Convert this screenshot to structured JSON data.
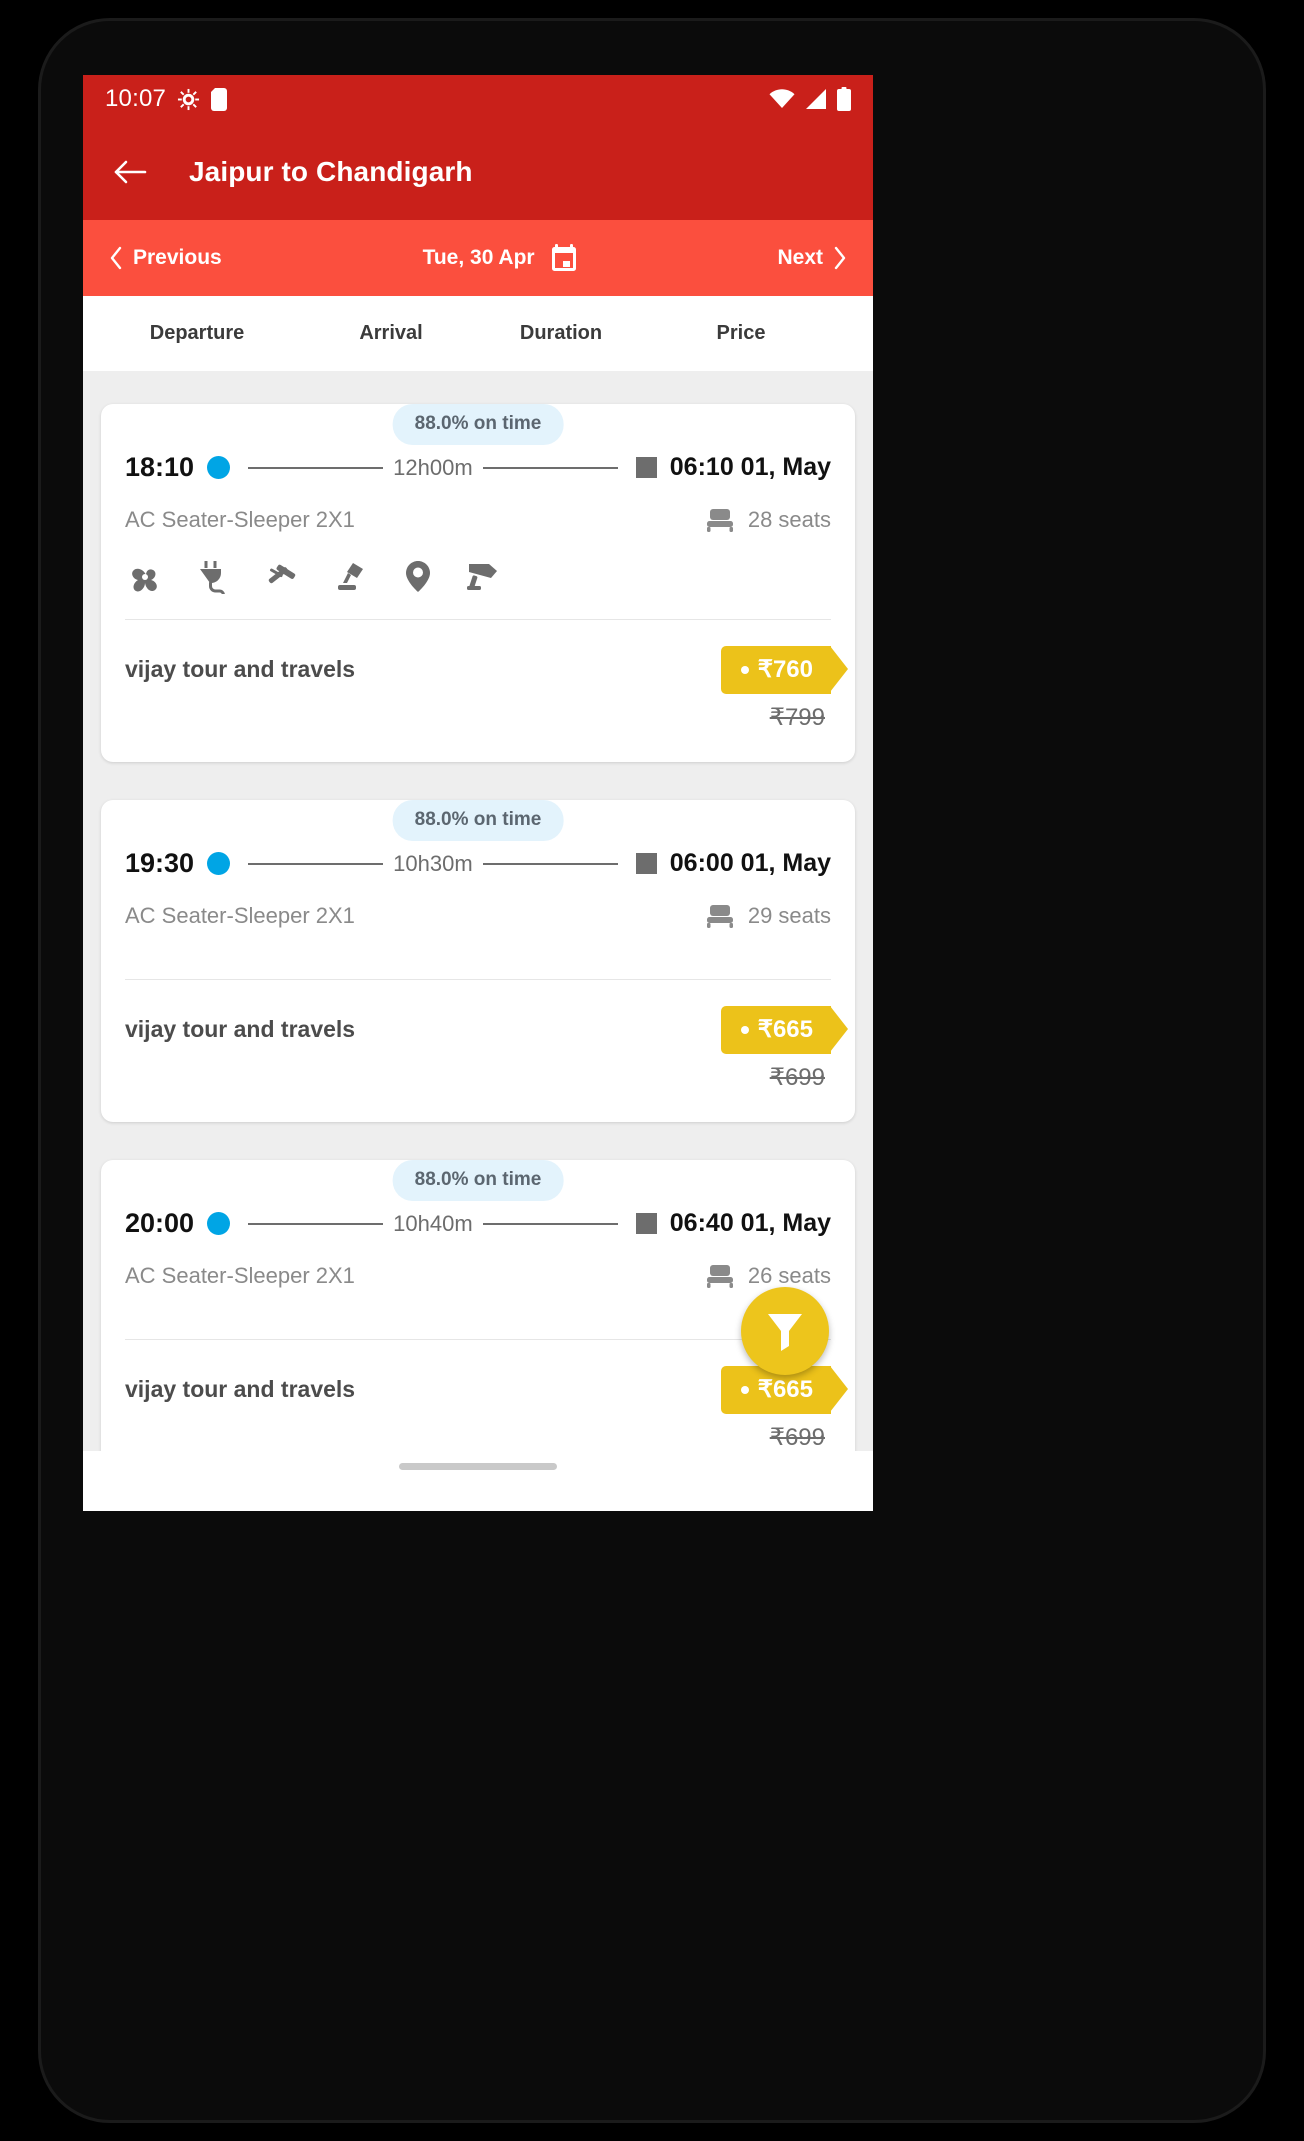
{
  "status_bar": {
    "time": "10:07",
    "icons": [
      "android-debug-icon",
      "sd-card-icon",
      "wifi-icon",
      "signal-icon",
      "battery-icon"
    ]
  },
  "app_bar": {
    "back_icon": "back-arrow-icon",
    "title": "Jaipur to Chandigarh"
  },
  "date_bar": {
    "previous_label": "Previous",
    "previous_icon": "chevron-left-icon",
    "date_label": "Tue, 30 Apr",
    "calendar_icon": "calendar-icon",
    "next_label": "Next",
    "next_icon": "chevron-right-icon"
  },
  "sort_headers": [
    {
      "label": "Departure"
    },
    {
      "label": "Arrival"
    },
    {
      "label": "Duration"
    },
    {
      "label": "Price"
    }
  ],
  "buses": [
    {
      "ontime": "88.0% on time",
      "departure": "18:10",
      "duration": "12h00m",
      "arrival": "06:10 01, May",
      "bus_type": "AC Seater-Sleeper 2X1",
      "seats": "28 seats",
      "amenities": [
        "fan-icon",
        "charging-point-icon",
        "hammer-icon",
        "reading-light-icon",
        "live-tracking-icon",
        "cctv-icon"
      ],
      "operator": "vijay tour and travels",
      "price": "₹760",
      "price_old": "₹799"
    },
    {
      "ontime": "88.0% on time",
      "departure": "19:30",
      "duration": "10h30m",
      "arrival": "06:00 01, May",
      "bus_type": "AC Seater-Sleeper 2X1",
      "seats": "29 seats",
      "amenities": [],
      "operator": "vijay tour and travels",
      "price": "₹665",
      "price_old": "₹699"
    },
    {
      "ontime": "88.0% on time",
      "departure": "20:00",
      "duration": "10h40m",
      "arrival": "06:40 01, May",
      "bus_type": "AC Seater-Sleeper 2X1",
      "seats": "26 seats",
      "amenities": [],
      "operator": "vijay tour and travels",
      "price": "₹665",
      "price_old": "₹699"
    }
  ],
  "fab": {
    "icon": "filter-funnel-icon"
  },
  "colors": {
    "status_bar": "#c9201a",
    "app_bar": "#c9201a",
    "date_bar": "#fb4f3e",
    "badge_bg": "#e3f3fc",
    "price_tag": "#ecc21a",
    "fab": "#edc51c",
    "dot": "#00a5e5"
  }
}
